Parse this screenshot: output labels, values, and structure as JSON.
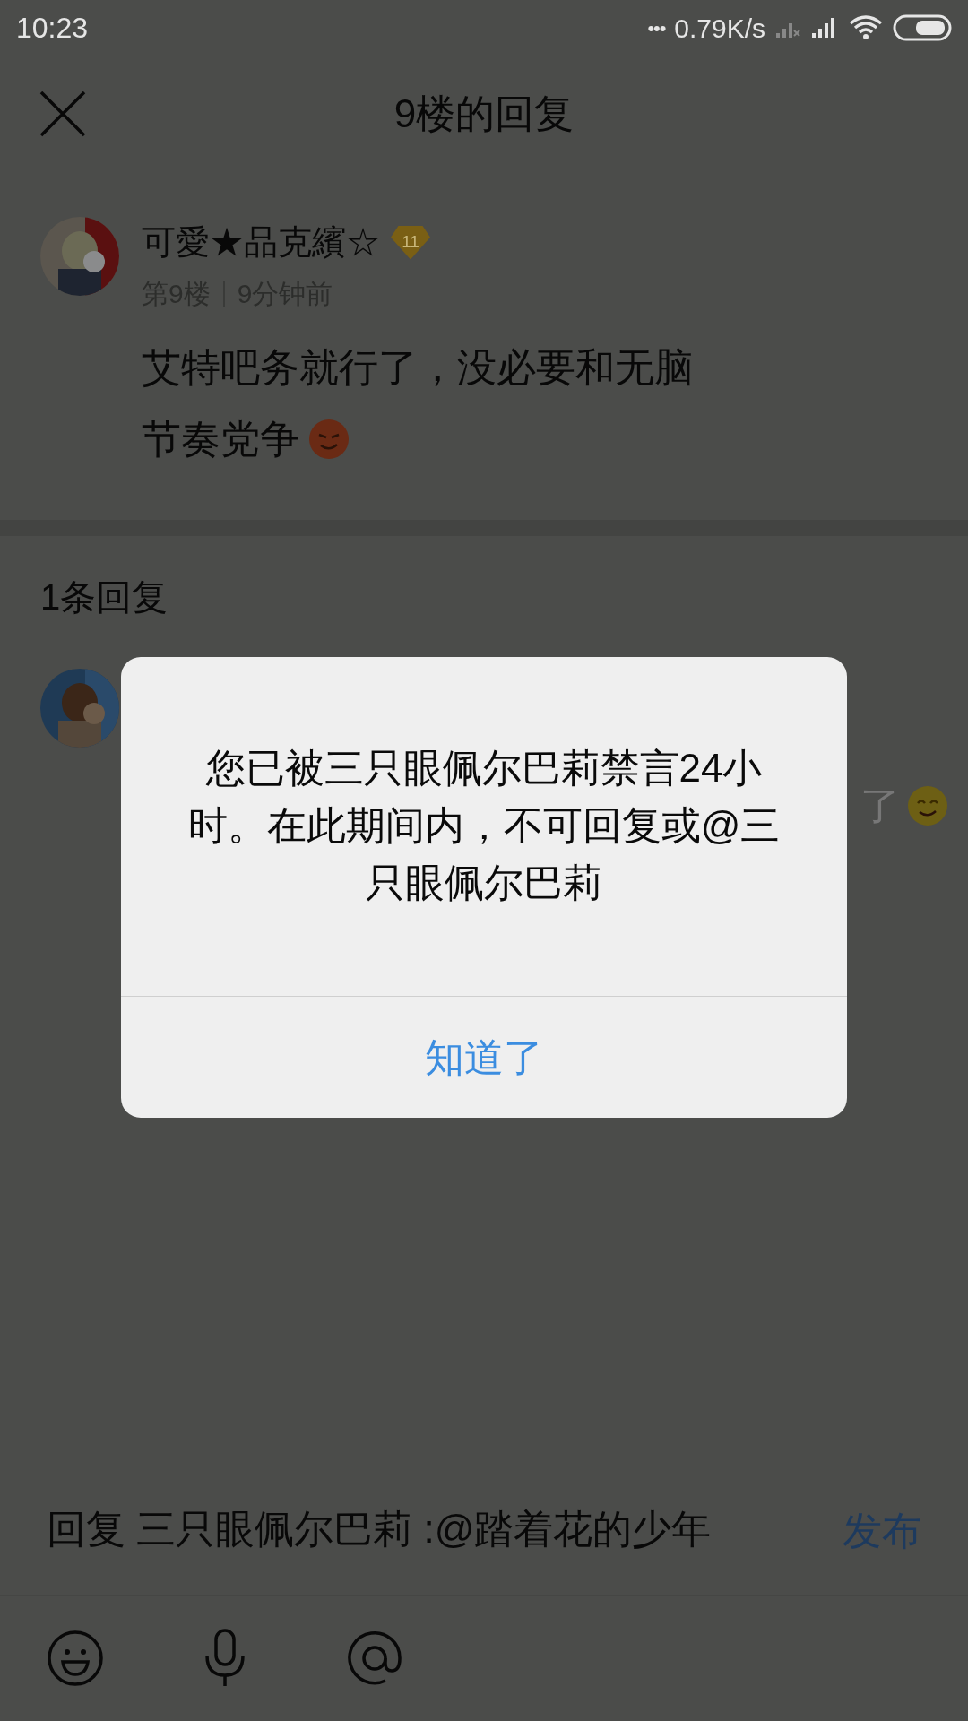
{
  "status_bar": {
    "time": "10:23",
    "dots": "•••",
    "speed": "0.79K/s"
  },
  "header": {
    "title": "9楼的回复"
  },
  "post": {
    "author": "可愛★品克繽☆",
    "level": "11",
    "floor": "第9楼",
    "time": "9分钟前",
    "lines": [
      "艾特吧务就行了，没必要和无脑",
      "节奏党争"
    ]
  },
  "replies_header": "1条回复",
  "reply": {
    "text_fragment": "了"
  },
  "dialog": {
    "message": "您已被三只眼佩尔巴莉禁言24小时。在此期间内，不可回复或@三只眼佩尔巴莉",
    "button": "知道了"
  },
  "composer": {
    "value": "回复 三只眼佩尔巴莉 :@踏着花的少年",
    "send": "发布"
  }
}
